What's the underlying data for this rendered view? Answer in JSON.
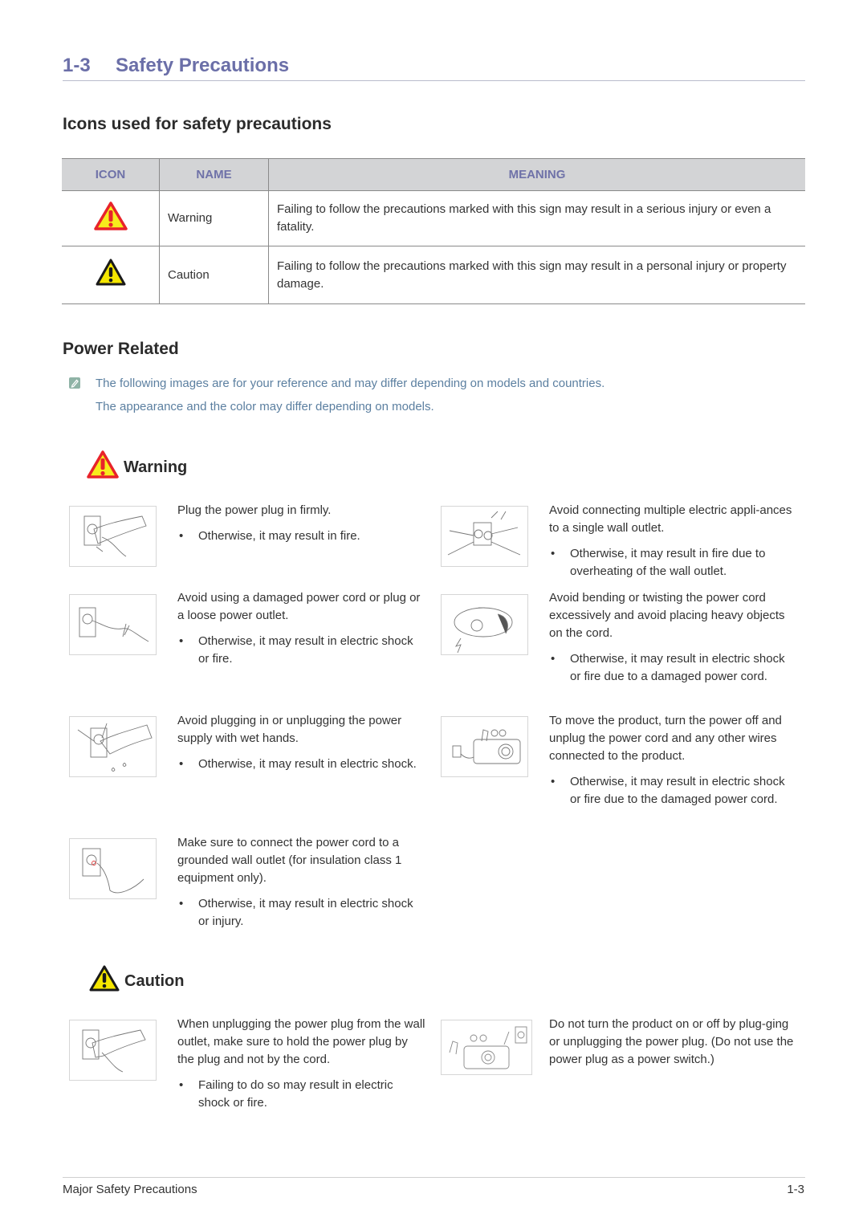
{
  "chapter": {
    "number": "1-3",
    "title": "Safety Precautions"
  },
  "icons_section": {
    "heading": "Icons used for safety precautions",
    "table": {
      "headers": [
        "ICON",
        "NAME",
        "MEANING"
      ],
      "rows": [
        {
          "icon": "warning-triangle-red-icon",
          "name": "Warning",
          "meaning": "Failing to follow the precautions marked with this sign may result in a serious injury or even a fatality."
        },
        {
          "icon": "caution-triangle-black-icon",
          "name": "Caution",
          "meaning": "Failing to follow the precautions marked with this sign may result in a personal injury or property damage."
        }
      ]
    }
  },
  "power_section": {
    "heading": "Power Related",
    "notes": [
      "The following images are for your reference and may differ depending on models and countries.",
      "The appearance and the color may differ depending on models."
    ],
    "warning": {
      "label": "Warning",
      "items": [
        {
          "text": "Plug the power plug in firmly.",
          "bullet": "Otherwise, it may result in fire.",
          "image": "hand-plugging-plug"
        },
        {
          "text": "Avoid connecting multiple electric appli-ances to a single wall outlet.",
          "bullet": "Otherwise, it may result in fire due to overheating of the wall outlet.",
          "image": "overloaded-outlet"
        },
        {
          "text": "Avoid using a damaged power cord or plug or a loose power outlet.",
          "bullet": "Otherwise, it may result in electric shock or fire.",
          "image": "damaged-cord"
        },
        {
          "text": "Avoid bending or twisting the power cord excessively and avoid placing heavy objects on the cord.",
          "bullet": "Otherwise, it may result in electric shock or fire due to a damaged power cord.",
          "image": "projector-on-cord"
        },
        {
          "text": "Avoid plugging in or unplugging the power supply with wet hands.",
          "bullet": "Otherwise, it may result in electric shock.",
          "image": "wet-hand-plug"
        },
        {
          "text": "To move the product, turn the power off and unplug the power cord and any other wires connected to the product.",
          "bullet": "Otherwise, it may result in electric shock or fire due to the damaged power cord.",
          "image": "projector-unplugged"
        },
        {
          "text": "Make sure to connect the power cord to a grounded wall outlet (for insulation class 1 equipment only).",
          "bullet": "Otherwise, it may result in electric shock or injury.",
          "image": "grounded-outlet"
        }
      ]
    },
    "caution": {
      "label": "Caution",
      "items": [
        {
          "text": "When unplugging the power plug from the wall outlet, make sure to hold the power plug by the plug and not by the cord.",
          "bullet": "Failing to do so may result in electric shock or fire.",
          "image": "hand-unplugging"
        },
        {
          "text": "Do not turn the product on or off by plug-ging or unplugging the power plug. (Do not use the power plug as a power switch.)",
          "bullet": "",
          "image": "projector-plug-switch"
        }
      ]
    }
  },
  "bullet_glyph": "•",
  "footer": {
    "left": "Major Safety Precautions",
    "right": "1-3"
  },
  "colors": {
    "accent": "#6b6fa8",
    "note": "#5b7fa0",
    "warning_red": "#e8232a",
    "caution_yellow": "#f5e600"
  }
}
